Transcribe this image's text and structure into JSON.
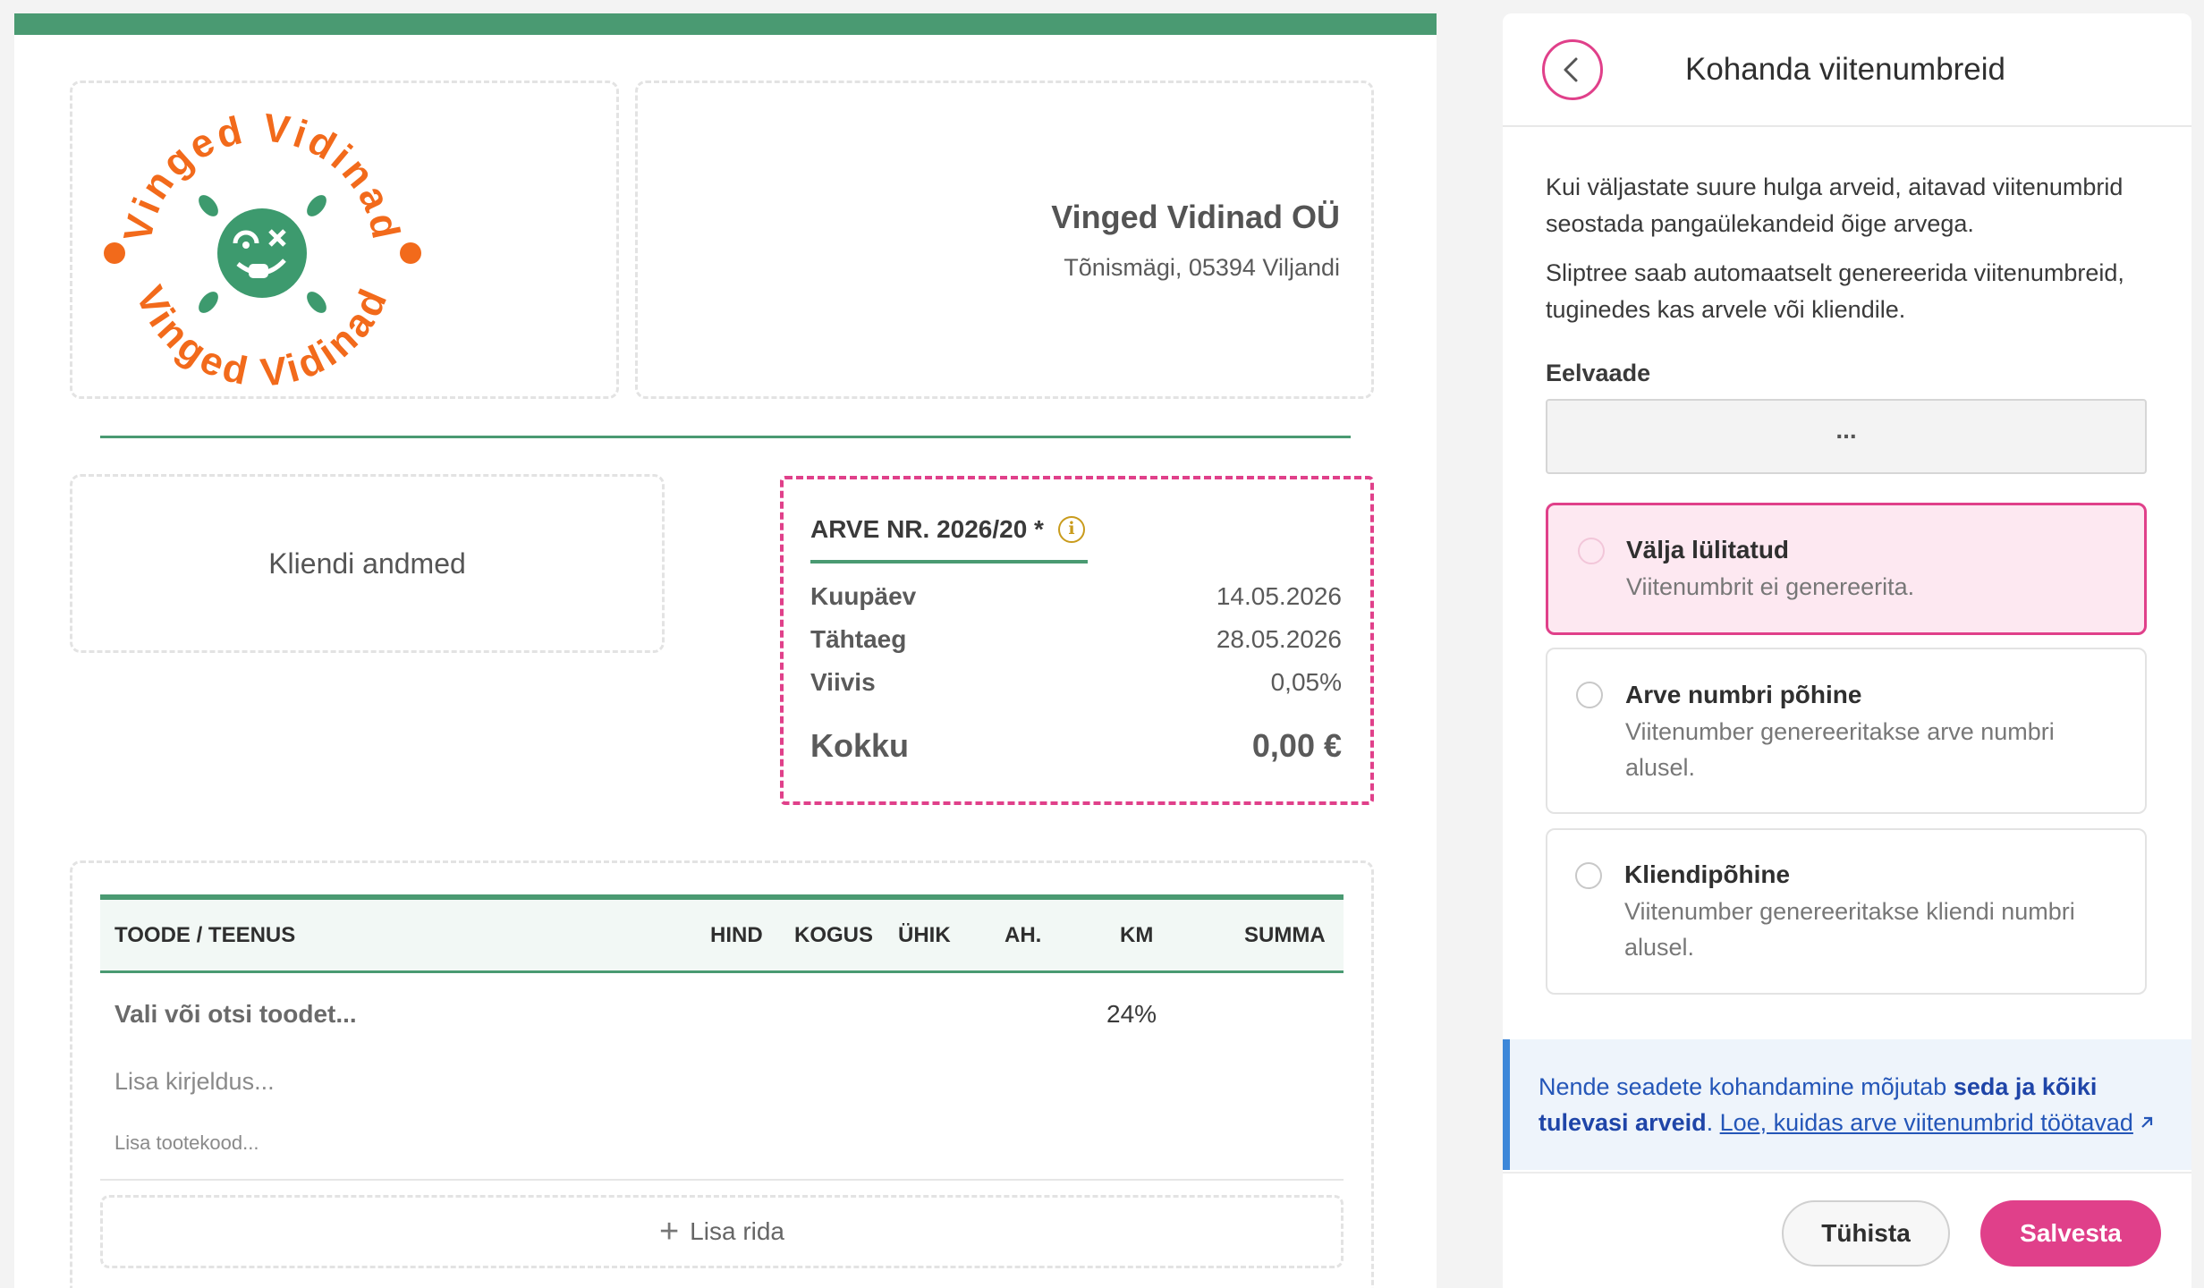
{
  "colors": {
    "brand_green": "#4a9a72",
    "accent_pink": "#e0408a",
    "logo_orange": "#f26a1b",
    "info_blue": "#2456b8"
  },
  "logo": {
    "arc_top": "Vinged Vidinad",
    "arc_bottom": "Vinged Vidinad",
    "icon": "dizzy-face-icon"
  },
  "company": {
    "name": "Vinged Vidinad OÜ",
    "address": "Tõnismägi, 05394 Viljandi"
  },
  "client": {
    "label": "Kliendi andmed"
  },
  "invoice": {
    "number": "ARVE NR. 2026/20 *",
    "info_icon": "info-icon",
    "rows": [
      {
        "label": "Kuupäev",
        "value": "14.05.2026"
      },
      {
        "label": "Tähtaeg",
        "value": "28.05.2026"
      },
      {
        "label": "Viivis",
        "value": "0,05%"
      }
    ],
    "total_label": "Kokku",
    "total_value": "0,00 €"
  },
  "items_table": {
    "headers": {
      "product": "TOODE / TEENUS",
      "price": "HIND",
      "qty": "KOGUS",
      "unit": "ÜHIK",
      "discount": "AH.",
      "vat": "KM",
      "sum": "SUMMA"
    },
    "row": {
      "product_placeholder": "Vali või otsi toodet...",
      "vat": "24%",
      "description_placeholder": "Lisa kirjeldus...",
      "code_placeholder": "Lisa tootekood..."
    },
    "add_row": "Lisa rida"
  },
  "panel": {
    "back_icon": "chevron-left-icon",
    "title": "Kohanda viitenumbreid",
    "intro_1": "Kui väljastate suure hulga arveid, aitavad viitenumbrid seostada pangaülekandeid õige arvega.",
    "intro_2": "Sliptree saab automaatselt genereerida viitenumbreid, tuginedes kas arvele või kliendile.",
    "preview_label": "Eelvaade",
    "preview_value": "...",
    "options": [
      {
        "title": "Välja lülitatud",
        "desc": "Viitenumbrit ei genereerita.",
        "selected": true
      },
      {
        "title": "Arve numbri põhine",
        "desc": "Viitenumber genereeritakse arve numbri alusel.",
        "selected": false
      },
      {
        "title": "Kliendipõhine",
        "desc": "Viitenumber genereeritakse kliendi numbri alusel.",
        "selected": false
      }
    ],
    "note": {
      "text_1": "Nende seadete kohandamine mõjutab ",
      "bold": "seda ja kõiki tulevasi arveid",
      "text_2": ". ",
      "link": "Loe, kuidas arve viitenumbrid töötavad",
      "link_icon": "external-link-icon"
    },
    "cancel": "Tühista",
    "save": "Salvesta"
  }
}
